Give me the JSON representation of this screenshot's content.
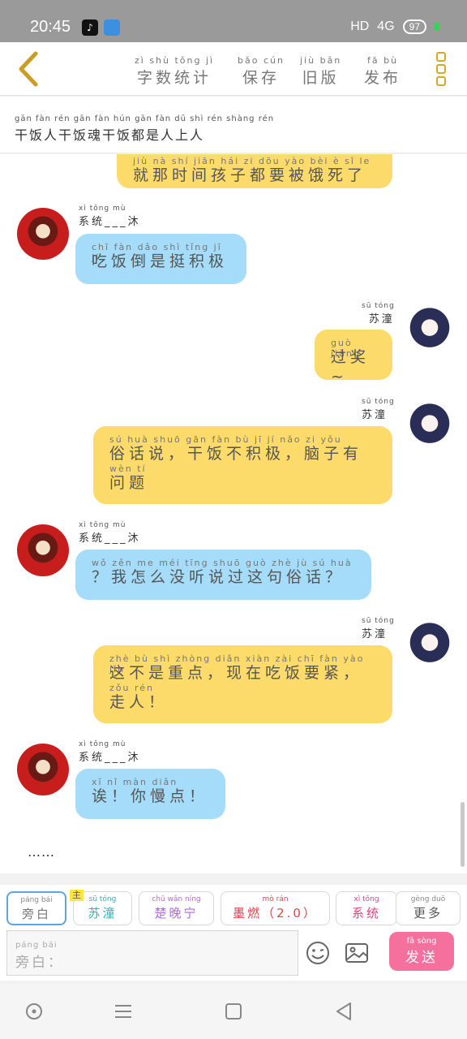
{
  "status": {
    "time": "20:45",
    "app1_icon": "tiktok-icon",
    "app2_icon": "arrow-up-icon",
    "network": "HD",
    "signal": "4G",
    "battery": "97"
  },
  "toolbar": {
    "back_icon": "chevron-left-icon",
    "items": [
      {
        "py": "zì shù tǒng jì",
        "cn": "字数统计"
      },
      {
        "py": "bǎo cún",
        "cn": "保存"
      },
      {
        "py": "jiù bǎn",
        "cn": "旧版"
      },
      {
        "py": "fā bù",
        "cn": "发布"
      }
    ],
    "more_icon": "more-vertical-icon"
  },
  "title": {
    "py": "gān fàn rén gān fàn hún gān fàn dū shì rén shàng rén",
    "cn": "干饭人干饭魂干饭都是人上人"
  },
  "chat": {
    "messages": [
      {
        "side": "right",
        "color": "yellow",
        "sender_py": "",
        "sender": "",
        "py": "jiù nà shí jiān hái zi dōu yào bèi è sǐ le",
        "cn": "就那时间孩子都要被饿死了"
      },
      {
        "side": "left",
        "color": "blue",
        "sender_py": "xì tǒng mù",
        "sender": "系统___沐",
        "py": "chī fàn dǎo shì tǐng jī jí",
        "cn": "吃饭倒是挺积极"
      },
      {
        "side": "right",
        "color": "yellow",
        "sender_py": "sū tóng",
        "sender": "苏潼",
        "py": "guò jiǎng",
        "cn": "过奖~"
      },
      {
        "side": "right",
        "color": "yellow",
        "sender_py": "sū tóng",
        "sender": "苏潼",
        "py": "sú huà shuō gān fàn bù jī jí nǎo zi yǒu",
        "cn": "俗话说，干饭不积极，脑子有",
        "py2": "wèn tí",
        "cn2": "问题"
      },
      {
        "side": "left",
        "color": "blue",
        "sender_py": "xì tǒng mù",
        "sender": "系统___沐",
        "py": "wǒ zěn me méi tīng shuō guò zhè jù sú huà",
        "cn": "？我怎么没听说过这句俗话？"
      },
      {
        "side": "right",
        "color": "yellow",
        "sender_py": "sū tóng",
        "sender": "苏潼",
        "py": "zhè bù shì zhòng diǎn xiàn zài chī fàn yào jǐn",
        "cn": "这不是重点，现在吃饭要紧，",
        "py2": "zǒu rén",
        "cn2": "走人！"
      },
      {
        "side": "left",
        "color": "blue",
        "sender_py": "xì tǒng mù",
        "sender": "系统___沐",
        "py": "xī nǐ màn diǎn",
        "cn": "诶！你慢点！"
      }
    ],
    "ellipsis": "……"
  },
  "roles": {
    "tag_main": "主",
    "items": [
      {
        "py": "páng bái",
        "cn": "旁白",
        "color": "#777777"
      },
      {
        "py": "sū tóng",
        "cn": "苏潼",
        "color": "#2ab3b3"
      },
      {
        "py": "chǔ wǎn níng",
        "cn": "楚晚宁",
        "color": "#b06be0"
      },
      {
        "py": "mò rán",
        "cn": "墨燃（2.0）",
        "color": "#e0434d"
      },
      {
        "py": "xì tǒng",
        "cn": "系统",
        "color": "#e0437d"
      },
      {
        "py": "gèng duō",
        "cn": "更多",
        "color": "#555555"
      }
    ]
  },
  "input": {
    "py": "páng bái",
    "placeholder": "旁白：",
    "emoji_icon": "smiley-icon",
    "image_icon": "image-icon",
    "send_py": "fā sòng",
    "send": "发送"
  },
  "nav": {
    "home_icon": "circle-dot-icon",
    "menu_icon": "menu-icon",
    "recents_icon": "square-icon",
    "back_icon": "triangle-back-icon"
  }
}
